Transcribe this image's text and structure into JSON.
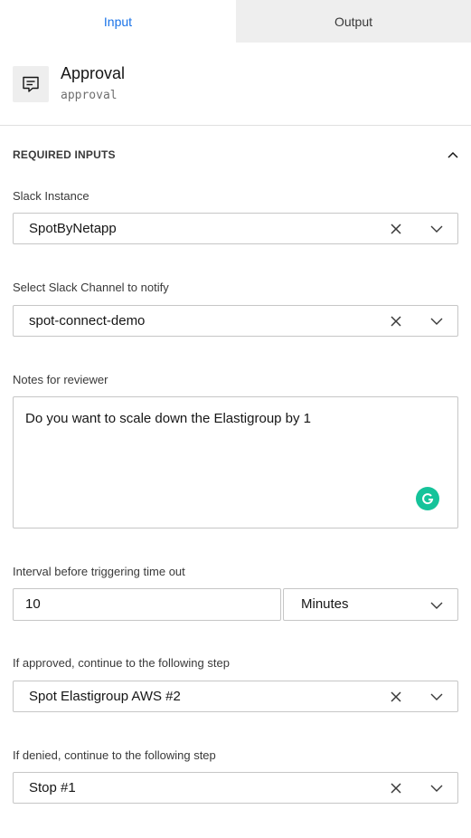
{
  "tabs": {
    "input": "Input",
    "output": "Output"
  },
  "step": {
    "title": "Approval",
    "id": "approval",
    "icon": "chat-message-icon"
  },
  "section": {
    "title": "REQUIRED INPUTS"
  },
  "fields": {
    "slack_instance": {
      "label": "Slack Instance",
      "value": "SpotByNetapp"
    },
    "slack_channel": {
      "label": "Select Slack Channel to notify",
      "value": "spot-connect-demo"
    },
    "notes": {
      "label": "Notes for reviewer",
      "value": "Do you want to scale down the Elastigroup by 1"
    },
    "interval": {
      "label": "Interval before triggering time out",
      "value": "10",
      "unit": "Minutes"
    },
    "approved_step": {
      "label": "If approved, continue to the following step",
      "value": "Spot Elastigroup AWS #2"
    },
    "denied_step": {
      "label": "If denied, continue to the following step",
      "value": "Stop #1"
    }
  },
  "colors": {
    "accent": "#1a73e8",
    "grammarly": "#15c39a",
    "border": "#c6c6c6"
  }
}
